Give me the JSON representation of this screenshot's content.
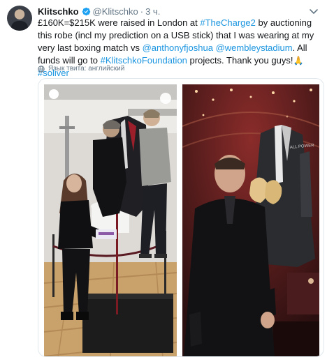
{
  "tweet": {
    "author_name": "Klitschko",
    "handle": "@Klitschko",
    "separator": "·",
    "time": "3 ч.",
    "text": {
      "p1": "£160K=$215K were raised in London at ",
      "tag1": "#TheCharge2",
      "p2": " by auctioning this robe (incl my prediction on a USB stick) that I was wearing at my very last boxing match vs ",
      "mention1": "@anthonyfjoshua",
      "p3": " ",
      "mention2": "@wembleystadium",
      "p4": ". All funds will go to ",
      "tag2": "#KlitschkoFoundation",
      "p5": " projects. Thank you guys!",
      "emoji": "🙏",
      "p6": " ",
      "tag3": "#soliver"
    },
    "language_label": "Язык твита: английский"
  },
  "colors": {
    "link": "#1b95e0",
    "verified": "#1da1f2",
    "muted": "#657786"
  },
  "icons": {
    "verified": "verified-badge-icon",
    "chevron": "chevron-down-icon",
    "globe": "globe-icon"
  }
}
